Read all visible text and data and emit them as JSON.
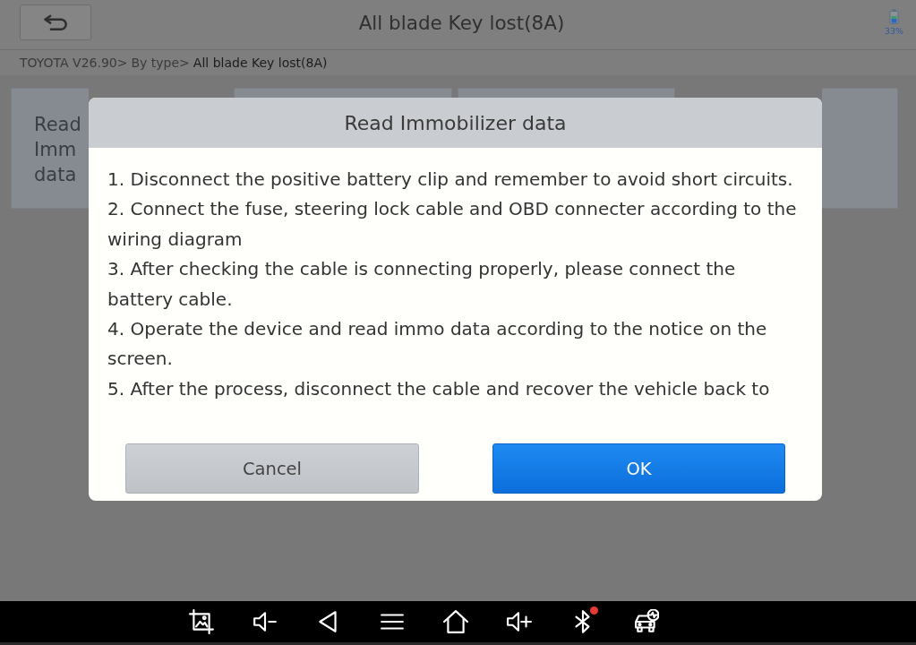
{
  "header": {
    "title": "All blade Key lost(8A)",
    "battery_text": "33%"
  },
  "breadcrumb": [
    {
      "label": "TOYOTA V26.90>",
      "current": false
    },
    {
      "label": "By type>",
      "current": false
    },
    {
      "label": "All blade Key lost(8A)",
      "current": true
    }
  ],
  "tiles": [
    {
      "label": "Read Imm data"
    }
  ],
  "dialog": {
    "title": "Read Immobilizer data",
    "steps": [
      "1. Disconnect the positive battery clip and remember to avoid short circuits.",
      "2. Connect the fuse, steering lock cable and OBD connecter according to the wiring diagram",
      "3. After checking the cable is connecting properly, please connect the battery cable.",
      "4. Operate the device and read immo data according to the notice on the screen.",
      "5. After the process, disconnect the cable and recover the vehicle back to"
    ],
    "buttons": [
      {
        "label": "Cancel",
        "kind": "secondary"
      },
      {
        "label": "OK",
        "kind": "primary"
      }
    ]
  },
  "nav_bar": {
    "icons": [
      {
        "kind": "screenshot",
        "alert": false
      },
      {
        "kind": "volume_down",
        "alert": false
      },
      {
        "kind": "back",
        "alert": false
      },
      {
        "kind": "menu",
        "alert": false
      },
      {
        "kind": "home",
        "alert": false
      },
      {
        "kind": "volume_up",
        "alert": false
      },
      {
        "kind": "bluetooth",
        "alert": true
      },
      {
        "kind": "car",
        "alert": false
      }
    ]
  }
}
